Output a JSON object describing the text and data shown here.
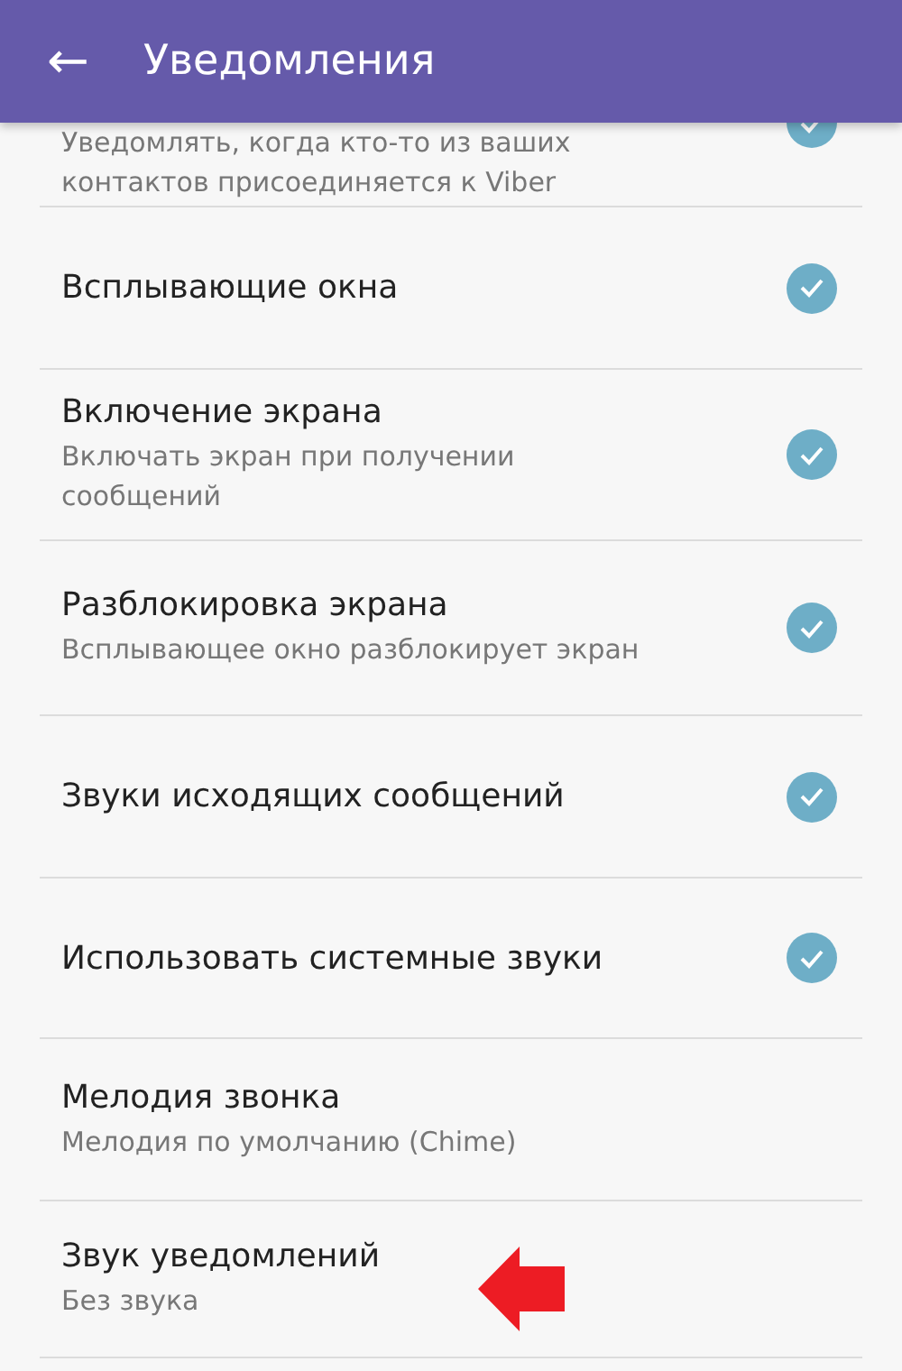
{
  "header": {
    "back_icon": "←",
    "title": "Уведомления"
  },
  "items": [
    {
      "kind": "checkbox",
      "partial": true,
      "subtitle": "Уведомлять, когда кто-то из ваших контактов присоединяется к Viber",
      "checked": true
    },
    {
      "kind": "checkbox",
      "title": "Всплывающие окна",
      "checked": true
    },
    {
      "kind": "checkbox",
      "title": "Включение экрана",
      "subtitle": "Включать экран при получении сообщений",
      "checked": true
    },
    {
      "kind": "checkbox",
      "title": "Разблокировка экрана",
      "subtitle": "Всплывающее окно разблокирует экран",
      "checked": true
    },
    {
      "kind": "checkbox",
      "title": "Звуки исходящих сообщений",
      "checked": true
    },
    {
      "kind": "checkbox",
      "title": "Использовать системные звуки",
      "checked": true
    },
    {
      "kind": "value",
      "title": "Мелодия звонка",
      "subtitle": "Мелодия по умолчанию (Chime)"
    },
    {
      "kind": "value",
      "title": "Звук уведомлений",
      "subtitle": "Без звука",
      "annotated": true
    }
  ]
}
